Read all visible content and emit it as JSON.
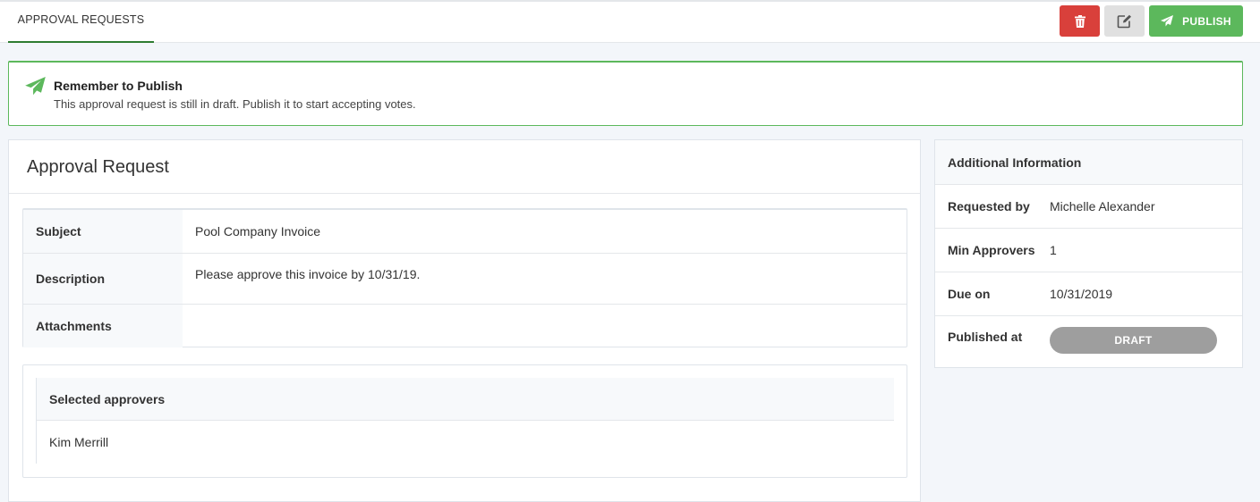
{
  "tabs": [
    {
      "label": "APPROVAL REQUESTS"
    }
  ],
  "toolbar": {
    "publish_label": "PUBLISH",
    "delete_icon": "trash-icon",
    "edit_icon": "edit-icon",
    "colors": {
      "delete": "#d9403b",
      "edit": "#e0e0e0",
      "publish": "#5cb85c"
    }
  },
  "alert": {
    "icon": "paper-plane-icon",
    "title": "Remember to Publish",
    "text": "This approval request is still in draft. Publish it to start accepting votes."
  },
  "request": {
    "title": "Approval Request",
    "fields": [
      {
        "label": "Subject",
        "value": "Pool Company Invoice"
      },
      {
        "label": "Description",
        "value": "Please approve this invoice by 10/31/19."
      },
      {
        "label": "Attachments",
        "value": ""
      }
    ],
    "approvers_header": "Selected approvers",
    "approvers": [
      "Kim Merrill"
    ]
  },
  "info": {
    "title": "Additional Information",
    "rows": [
      {
        "label": "Requested by",
        "value": "Michelle Alexander"
      },
      {
        "label": "Min Approvers",
        "value": "1"
      },
      {
        "label": "Due on",
        "value": "10/31/2019"
      },
      {
        "label": "Published at",
        "value": "DRAFT"
      }
    ]
  }
}
